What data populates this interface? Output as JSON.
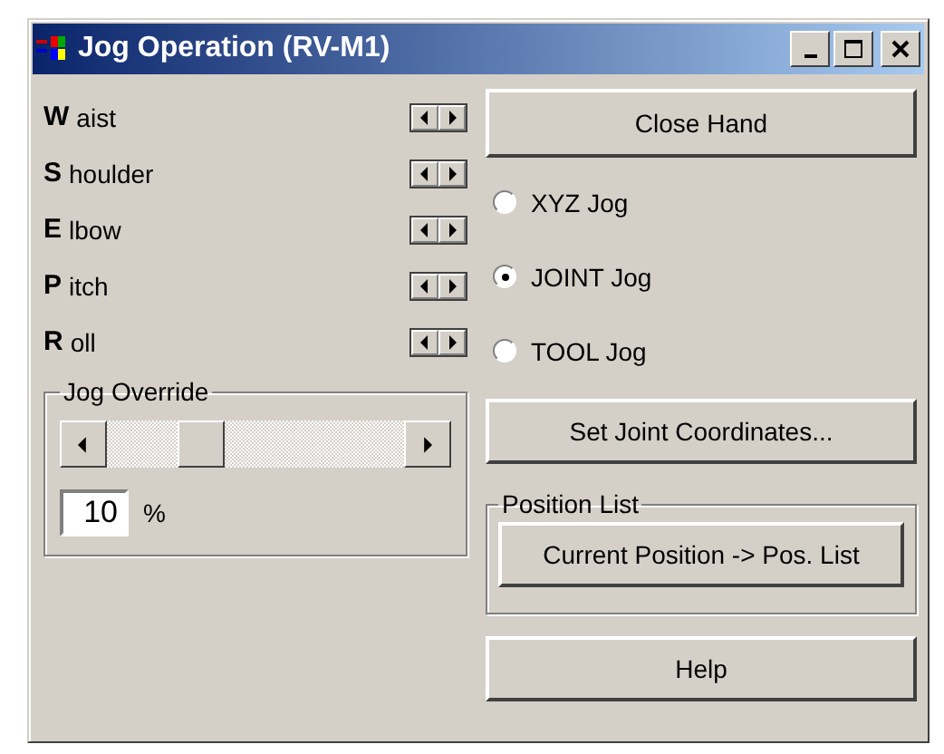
{
  "window": {
    "title": "Jog Operation (RV-M1)"
  },
  "axes": [
    {
      "key": "W",
      "rest": "aist"
    },
    {
      "key": "S",
      "rest": "houlder"
    },
    {
      "key": "E",
      "rest": "lbow"
    },
    {
      "key": "P",
      "rest": "itch"
    },
    {
      "key": "R",
      "rest": "oll"
    }
  ],
  "jog_override": {
    "label": "Jog Override",
    "level": 0.28,
    "value": "10",
    "unit": "%"
  },
  "close_hand_button": "Close Hand",
  "jog_modes": [
    {
      "label": "XYZ Jog",
      "selected": false
    },
    {
      "label": "JOINT Jog",
      "selected": true
    },
    {
      "label": "TOOL Jog",
      "selected": false
    }
  ],
  "set_joint_button": "Set Joint Coordinates...",
  "position_list": {
    "label": "Position List",
    "button": "Current Position -> Pos. List"
  },
  "help_button": "Help"
}
